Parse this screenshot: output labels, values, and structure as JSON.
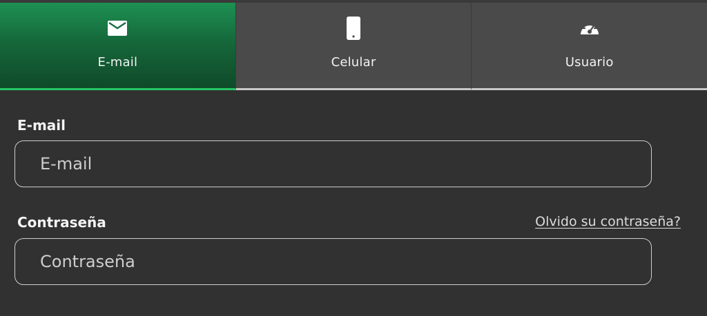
{
  "tabs": [
    {
      "label": "E-mail",
      "icon": "envelope-icon",
      "active": true
    },
    {
      "label": "Celular",
      "icon": "mobile-phone-icon",
      "active": false
    },
    {
      "label": "Usuario",
      "icon": "speedometer-icon",
      "active": false
    }
  ],
  "form": {
    "email_label": "E-mail",
    "email_placeholder": "E-mail",
    "password_label": "Contraseña",
    "password_placeholder": "Contraseña",
    "forgot_link": "Olvido su contraseña?"
  },
  "colors": {
    "active_tab_top": "#1d9152",
    "active_tab_bottom": "#0f4a29",
    "active_underline": "#27c764",
    "tab_bg": "#4a4a4a",
    "page_bg": "#313131"
  }
}
